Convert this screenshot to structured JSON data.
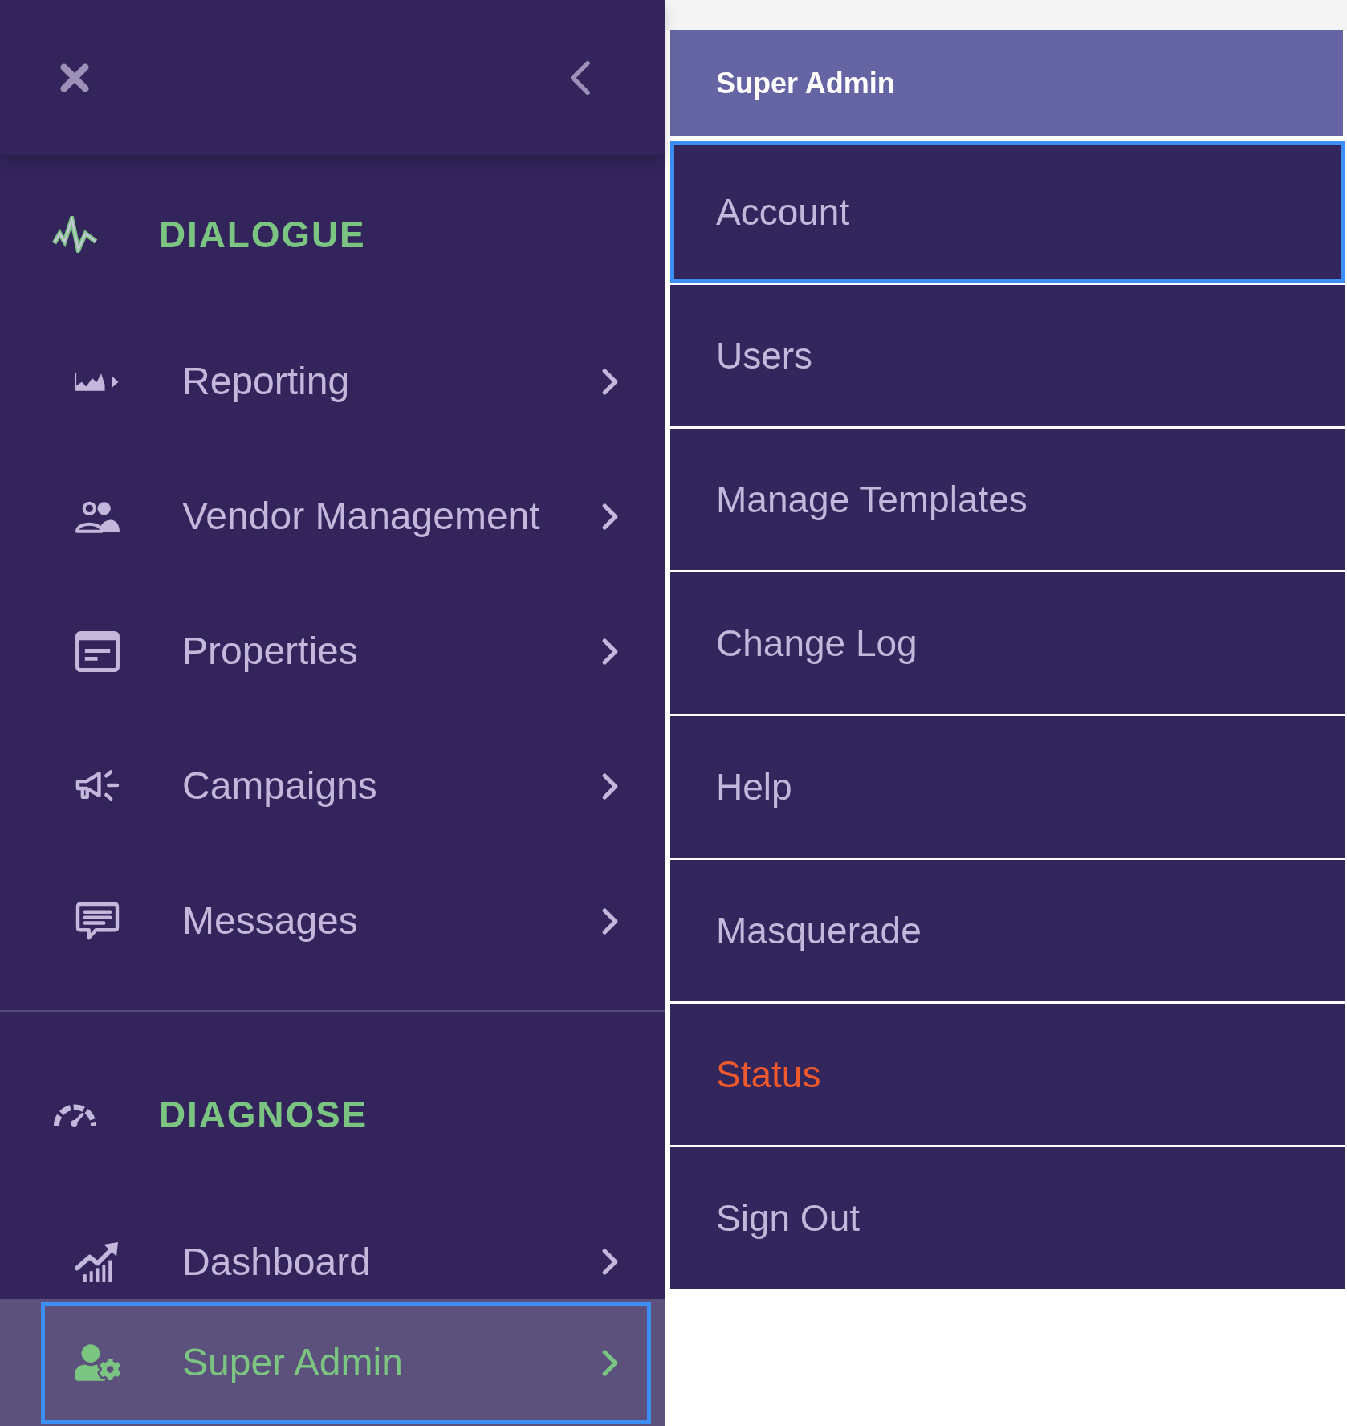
{
  "sidebar": {
    "sections": [
      {
        "heading": "DIALOGUE",
        "items": [
          {
            "label": "Reporting",
            "selected": false
          },
          {
            "label": "Vendor Management",
            "selected": false
          },
          {
            "label": "Properties",
            "selected": false
          },
          {
            "label": "Campaigns",
            "selected": false
          },
          {
            "label": "Messages",
            "selected": false
          }
        ]
      },
      {
        "heading": "DIAGNOSE",
        "items": [
          {
            "label": "Dashboard",
            "selected": false
          },
          {
            "label": "Super Admin",
            "selected": true
          }
        ]
      }
    ]
  },
  "menu": {
    "title": "Super Admin",
    "items": [
      {
        "label": "Account",
        "selected": true,
        "warning": false
      },
      {
        "label": "Users",
        "selected": false,
        "warning": false
      },
      {
        "label": "Manage Templates",
        "selected": false,
        "warning": false
      },
      {
        "label": "Change Log",
        "selected": false,
        "warning": false
      },
      {
        "label": "Help",
        "selected": false,
        "warning": false
      },
      {
        "label": "Masquerade",
        "selected": false,
        "warning": false
      },
      {
        "label": "Status",
        "selected": false,
        "warning": true
      },
      {
        "label": "Sign Out",
        "selected": false,
        "warning": false
      }
    ]
  }
}
